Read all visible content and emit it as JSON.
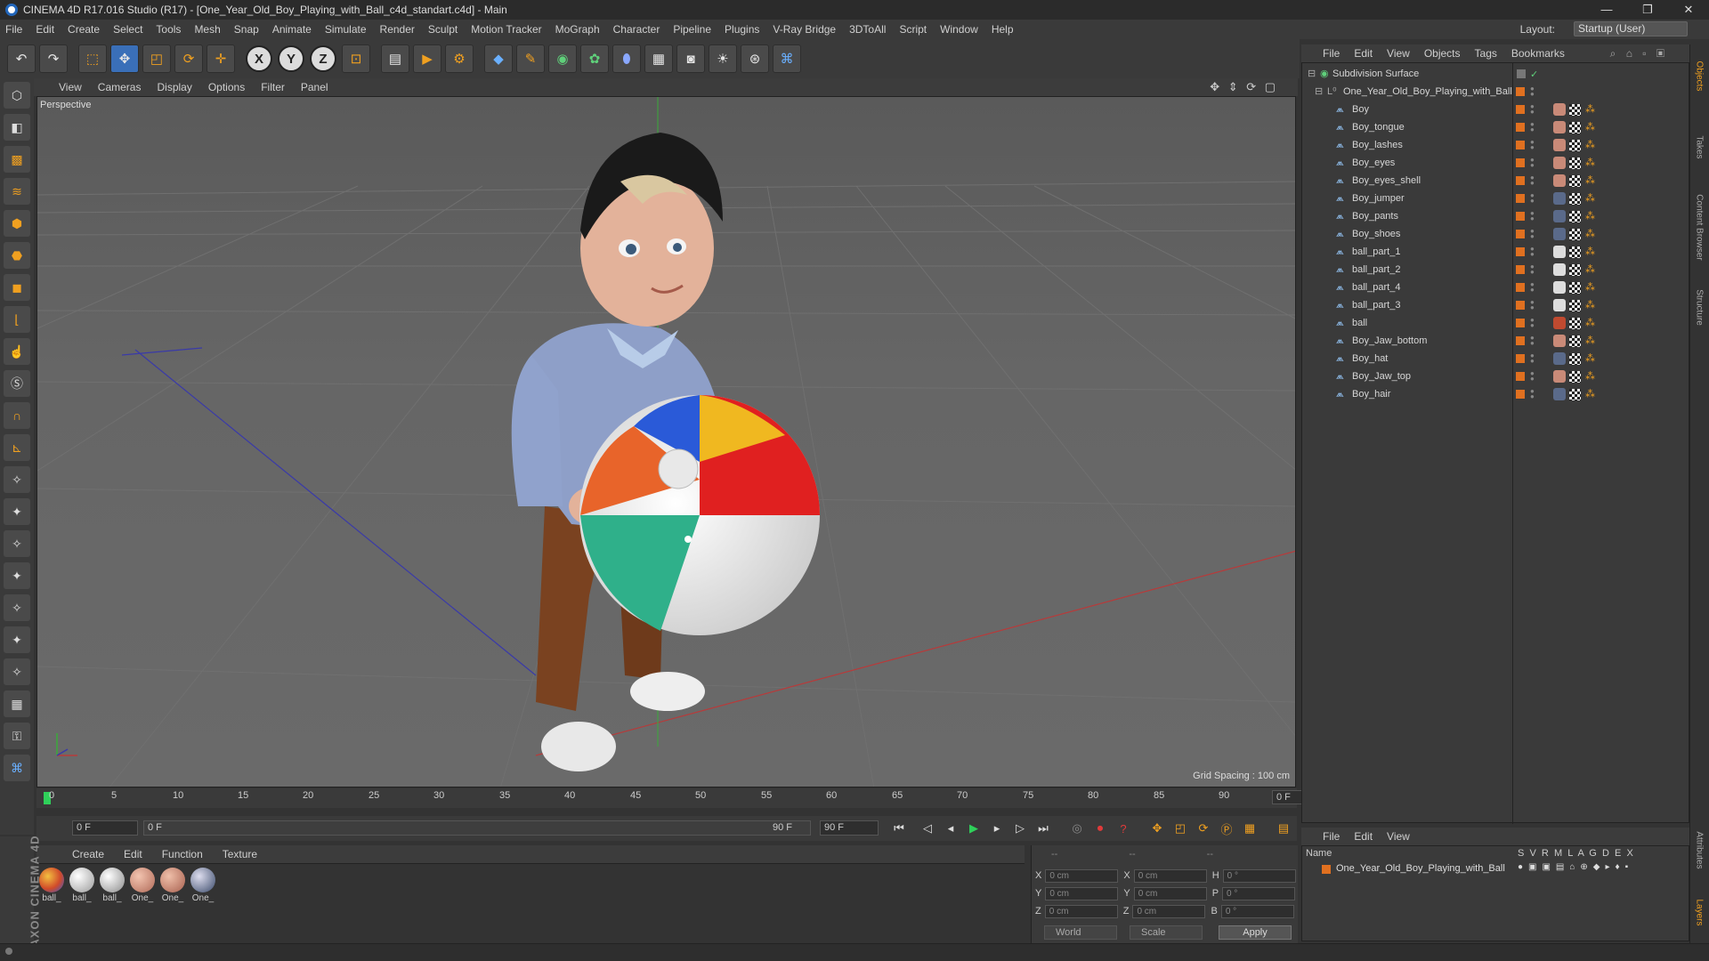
{
  "window": {
    "title": "CINEMA 4D R17.016 Studio (R17) - [One_Year_Old_Boy_Playing_with_Ball_c4d_standart.c4d] - Main",
    "minimize": "—",
    "restore": "❐",
    "close": "✕"
  },
  "menubar": {
    "items": [
      "File",
      "Edit",
      "Create",
      "Select",
      "Tools",
      "Mesh",
      "Snap",
      "Animate",
      "Simulate",
      "Render",
      "Sculpt",
      "Motion Tracker",
      "MoGraph",
      "Character",
      "Pipeline",
      "Plugins",
      "V-Ray Bridge",
      "3DToAll",
      "Script",
      "Window",
      "Help"
    ],
    "layout_label": "Layout:",
    "layout_value": "Startup (User)"
  },
  "viewport": {
    "menu": [
      "View",
      "Cameras",
      "Display",
      "Options",
      "Filter",
      "Panel"
    ],
    "label": "Perspective",
    "grid_spacing": "Grid Spacing : 100 cm",
    "nav_icons": "✥ ⇕ ⟳ ▢"
  },
  "timeline": {
    "ticks": [
      "0",
      "5",
      "10",
      "15",
      "20",
      "25",
      "30",
      "35",
      "40",
      "45",
      "50",
      "55",
      "60",
      "65",
      "70",
      "75",
      "80",
      "85",
      "90"
    ],
    "current_frame": "0 F"
  },
  "playback": {
    "start": "0 F",
    "range_start": "0 F",
    "range_end": "90 F",
    "end": "90 F"
  },
  "materials": {
    "menu": [
      "Create",
      "Edit",
      "Function",
      "Texture"
    ],
    "items": [
      {
        "label": "ball_",
        "color": "#d04a2a"
      },
      {
        "label": "ball_",
        "color": "#e8e8e8"
      },
      {
        "label": "ball_",
        "color": "#dcdcdc"
      },
      {
        "label": "One_",
        "color": "#d9a08a"
      },
      {
        "label": "One_",
        "color": "#d39682"
      },
      {
        "label": "One_",
        "color": "#5a6a8a"
      }
    ]
  },
  "coords": {
    "header": [
      "--",
      "--",
      "--"
    ],
    "rows": [
      {
        "a": "X",
        "av": "0 cm",
        "b": "X",
        "bv": "0 cm",
        "c": "H",
        "cv": "0 °"
      },
      {
        "a": "Y",
        "av": "0 cm",
        "b": "Y",
        "bv": "0 cm",
        "c": "P",
        "cv": "0 °"
      },
      {
        "a": "Z",
        "av": "0 cm",
        "b": "Z",
        "bv": "0 cm",
        "c": "B",
        "cv": "0 °"
      }
    ],
    "world": "World",
    "scale": "Scale",
    "apply": "Apply"
  },
  "objects": {
    "menu": [
      "File",
      "Edit",
      "View",
      "Objects",
      "Tags",
      "Bookmarks"
    ],
    "root": "Subdivision Surface",
    "group": "One_Year_Old_Boy_Playing_with_Ball",
    "items": [
      {
        "name": "Boy",
        "tag": "#c98a78"
      },
      {
        "name": "Boy_tongue",
        "tag": "#c98a78"
      },
      {
        "name": "Boy_lashes",
        "tag": "#c98a78"
      },
      {
        "name": "Boy_eyes",
        "tag": "#c98a78"
      },
      {
        "name": "Boy_eyes_shell",
        "tag": "#c98a78"
      },
      {
        "name": "Boy_jumper",
        "tag": "#5a6a8a"
      },
      {
        "name": "Boy_pants",
        "tag": "#5a6a8a"
      },
      {
        "name": "Boy_shoes",
        "tag": "#5a6a8a"
      },
      {
        "name": "ball_part_1",
        "tag": "#dddddd"
      },
      {
        "name": "ball_part_2",
        "tag": "#dddddd"
      },
      {
        "name": "ball_part_4",
        "tag": "#dddddd"
      },
      {
        "name": "ball_part_3",
        "tag": "#dddddd"
      },
      {
        "name": "ball",
        "tag": "#c04a30"
      },
      {
        "name": "Boy_Jaw_bottom",
        "tag": "#c98a78"
      },
      {
        "name": "Boy_hat",
        "tag": "#5a6a8a"
      },
      {
        "name": "Boy_Jaw_top",
        "tag": "#c98a78"
      },
      {
        "name": "Boy_hair",
        "tag": "#5a6a8a"
      }
    ]
  },
  "layers": {
    "menu": [
      "File",
      "Edit",
      "View"
    ],
    "header_name": "Name",
    "header_cols": "S  V  R  M  L  A  G  D  E  X",
    "row": "One_Year_Old_Boy_Playing_with_Ball"
  },
  "right_tabs": [
    "Objects",
    "Takes",
    "Content Browser",
    "Structure",
    "Attributes",
    "Layers"
  ],
  "brand": "MAXON CINEMA 4D"
}
